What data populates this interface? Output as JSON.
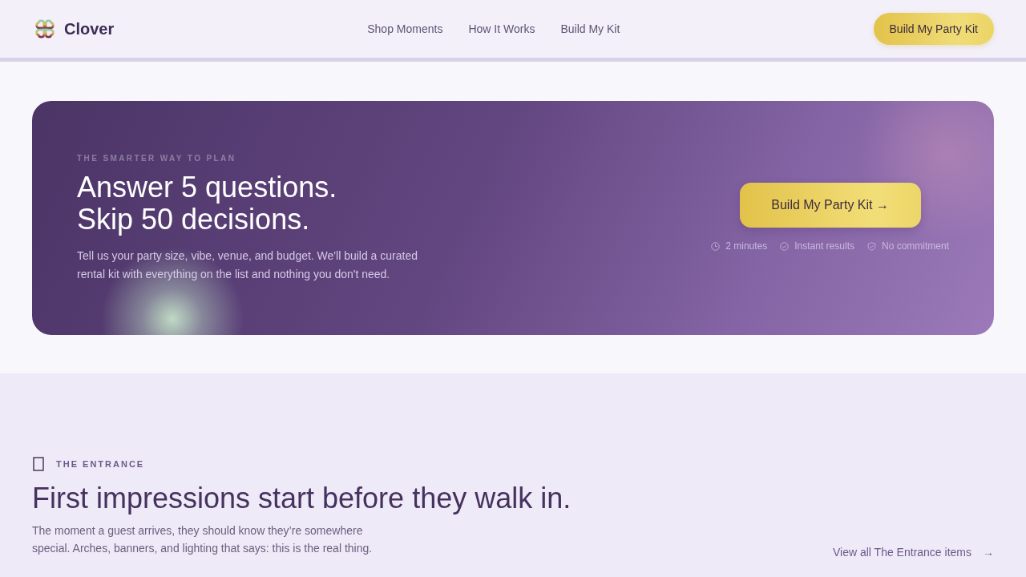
{
  "header": {
    "brand": "Clover",
    "nav": [
      "Shop Moments",
      "How It Works",
      "Build My Kit"
    ],
    "cta": "Build My Party Kit"
  },
  "hero": {
    "eyebrow": "THE SMARTER WAY TO PLAN",
    "headline": [
      "Answer 5 questions.",
      "Skip 50 decisions."
    ],
    "body": "Tell us your party size, vibe, venue, and budget. We'll build a curated rental kit with everything on the list and nothing you don't need.",
    "cta": "Build My Party Kit →",
    "perks": [
      {
        "kind": "clock",
        "label": "2 minutes"
      },
      {
        "kind": "check",
        "label": "Instant results"
      },
      {
        "kind": "shield",
        "label": "No commitment"
      }
    ]
  },
  "section": {
    "eyebrow": "THE ENTRANCE",
    "title": "First impressions start before they walk in.",
    "body": "The moment a guest arrives, they should know they’re somewhere special. Arches, banners, and lighting that says: this is the real thing.",
    "link": {
      "label": "View all The Entrance items",
      "arrow": "→"
    }
  }
}
